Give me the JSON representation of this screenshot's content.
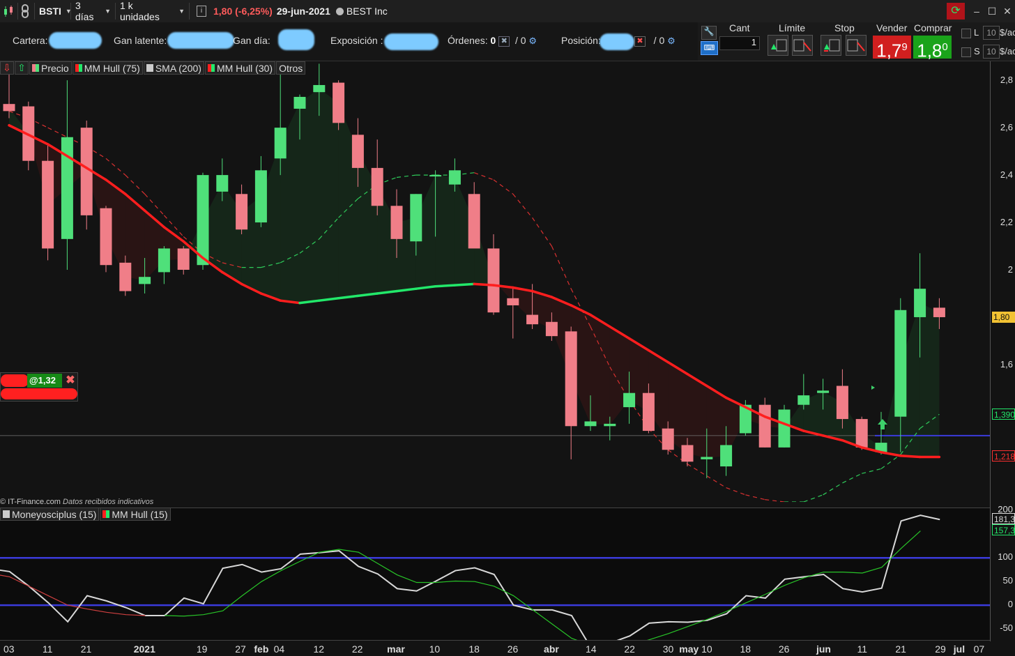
{
  "toolbar": {
    "symbol": "BSTI",
    "timeframe": "3 días",
    "units": "1 k unidades",
    "change": "1,80 (-6,25%)",
    "date": "29-jun-2021",
    "company": "BEST Inc"
  },
  "account": {
    "cartera_label": "Cartera:",
    "gan_latente_label": "Gan latente:",
    "gan_dia_label": "Gan día:",
    "exposicion_label": "Exposición :",
    "ordenes_label": "Órdenes:",
    "ordenes_value": "0",
    "ordenes_pending": "/ 0",
    "posicion_label": "Posición:",
    "posicion_pending": "/ 0"
  },
  "trade": {
    "cant_label": "Cant",
    "qty": "1",
    "limite_label": "Límite",
    "stop_label": "Stop",
    "vender_label": "Vender",
    "comprar_label": "Comprar",
    "sell_price": "1,7",
    "sell_sup": "9",
    "buy_price": "1,8",
    "buy_sup": "0",
    "L_label": "L",
    "S_label": "S",
    "L_value": "10",
    "S_value": "10",
    "L_unit": "$/ac",
    "S_unit": "$/ac"
  },
  "legend": {
    "precio": "Precio",
    "hull75": "MM Hull (75)",
    "sma200": "SMA (200)",
    "hull30": "MM Hull (30)",
    "otros": "Otros"
  },
  "order_marker": {
    "label": "@1,32"
  },
  "copyright": {
    "brand": "© IT-Finance.com",
    "note": "Datos recibidos indicativos"
  },
  "lower_legend": {
    "money": "Moneyosciplus (15)",
    "hull15": "MM Hull (15)"
  },
  "colors": {
    "bull": "#4fe07a",
    "bear": "#f07e88",
    "hull_down": "#ff1e1e",
    "hull_up": "#22e86a",
    "buy_bg": "#1aa31a",
    "sell_bg": "#d11f1f",
    "level_line": "#3b3bdc"
  },
  "chart_data": [
    {
      "type": "candlestick",
      "title": "",
      "ylim": [
        1.02,
        2.88
      ],
      "yticks": [
        "2,8",
        "2,6",
        "2,4",
        "2,2",
        "2",
        "1,6"
      ],
      "ytick_values": [
        2.8,
        2.6,
        2.4,
        2.2,
        2.0,
        1.6
      ],
      "price_tags": [
        {
          "label": "1,80",
          "value": 1.8,
          "color": "#f2c233"
        },
        {
          "label": "1,390",
          "value": 1.39,
          "color": "#22e86a"
        },
        {
          "label": "1,218",
          "value": 1.215,
          "color": "#ff3030"
        }
      ],
      "level_line": 1.3,
      "candles": [
        {
          "o": 2.7,
          "h": 2.84,
          "l": 2.64,
          "c": 2.67
        },
        {
          "o": 2.69,
          "h": 2.71,
          "l": 2.42,
          "c": 2.46
        },
        {
          "o": 2.46,
          "h": 2.53,
          "l": 2.04,
          "c": 2.09
        },
        {
          "o": 2.13,
          "h": 2.8,
          "l": 2.0,
          "c": 2.56
        },
        {
          "o": 2.6,
          "h": 2.63,
          "l": 2.17,
          "c": 2.23
        },
        {
          "o": 2.26,
          "h": 2.27,
          "l": 1.99,
          "c": 2.02
        },
        {
          "o": 2.03,
          "h": 2.06,
          "l": 1.89,
          "c": 1.91
        },
        {
          "o": 1.94,
          "h": 2.05,
          "l": 1.9,
          "c": 1.97
        },
        {
          "o": 1.99,
          "h": 2.1,
          "l": 1.94,
          "c": 2.09
        },
        {
          "o": 2.09,
          "h": 2.1,
          "l": 1.98,
          "c": 2.0
        },
        {
          "o": 2.02,
          "h": 2.41,
          "l": 2.0,
          "c": 2.4
        },
        {
          "o": 2.33,
          "h": 2.47,
          "l": 2.29,
          "c": 2.4
        },
        {
          "o": 2.32,
          "h": 2.36,
          "l": 2.15,
          "c": 2.17
        },
        {
          "o": 2.2,
          "h": 2.48,
          "l": 2.18,
          "c": 2.42
        },
        {
          "o": 2.47,
          "h": 2.9,
          "l": 2.4,
          "c": 2.6
        },
        {
          "o": 2.68,
          "h": 2.74,
          "l": 2.55,
          "c": 2.73
        },
        {
          "o": 2.75,
          "h": 2.87,
          "l": 2.65,
          "c": 2.78
        },
        {
          "o": 2.79,
          "h": 2.8,
          "l": 2.59,
          "c": 2.62
        },
        {
          "o": 2.57,
          "h": 2.64,
          "l": 2.35,
          "c": 2.43
        },
        {
          "o": 2.43,
          "h": 2.55,
          "l": 2.23,
          "c": 2.27
        },
        {
          "o": 2.27,
          "h": 2.34,
          "l": 2.05,
          "c": 2.13
        },
        {
          "o": 2.12,
          "h": 2.32,
          "l": 2.06,
          "c": 2.32
        },
        {
          "o": 2.4,
          "h": 2.42,
          "l": 2.14,
          "c": 2.4
        },
        {
          "o": 2.36,
          "h": 2.47,
          "l": 2.33,
          "c": 2.42
        },
        {
          "o": 2.32,
          "h": 2.37,
          "l": 2.17,
          "c": 2.09
        },
        {
          "o": 2.09,
          "h": 2.15,
          "l": 1.81,
          "c": 1.82
        },
        {
          "o": 1.88,
          "h": 1.93,
          "l": 1.71,
          "c": 1.85
        },
        {
          "o": 1.81,
          "h": 1.94,
          "l": 1.75,
          "c": 1.77
        },
        {
          "o": 1.78,
          "h": 1.82,
          "l": 1.7,
          "c": 1.72
        },
        {
          "o": 1.74,
          "h": 1.76,
          "l": 1.2,
          "c": 1.34
        },
        {
          "o": 1.34,
          "h": 1.47,
          "l": 1.32,
          "c": 1.36
        },
        {
          "o": 1.34,
          "h": 1.38,
          "l": 1.28,
          "c": 1.35
        },
        {
          "o": 1.42,
          "h": 1.57,
          "l": 1.35,
          "c": 1.48
        },
        {
          "o": 1.48,
          "h": 1.52,
          "l": 1.31,
          "c": 1.32
        },
        {
          "o": 1.33,
          "h": 1.36,
          "l": 1.22,
          "c": 1.24
        },
        {
          "o": 1.26,
          "h": 1.29,
          "l": 1.17,
          "c": 1.19
        },
        {
          "o": 1.2,
          "h": 1.33,
          "l": 1.12,
          "c": 1.21
        },
        {
          "o": 1.17,
          "h": 1.34,
          "l": 1.13,
          "c": 1.26
        },
        {
          "o": 1.31,
          "h": 1.45,
          "l": 1.3,
          "c": 1.43
        },
        {
          "o": 1.43,
          "h": 1.46,
          "l": 1.25,
          "c": 1.25
        },
        {
          "o": 1.25,
          "h": 1.43,
          "l": 1.25,
          "c": 1.41
        },
        {
          "o": 1.43,
          "h": 1.56,
          "l": 1.41,
          "c": 1.47
        },
        {
          "o": 1.48,
          "h": 1.54,
          "l": 1.41,
          "c": 1.49
        },
        {
          "o": 1.51,
          "h": 1.58,
          "l": 1.33,
          "c": 1.37
        },
        {
          "o": 1.37,
          "h": 1.38,
          "l": 1.24,
          "c": 1.25
        },
        {
          "o": 1.23,
          "h": 1.4,
          "l": 1.22,
          "c": 1.27
        },
        {
          "o": 1.38,
          "h": 1.88,
          "l": 1.23,
          "c": 1.83
        },
        {
          "o": 1.8,
          "h": 2.07,
          "l": 1.63,
          "c": 1.92
        },
        {
          "o": 1.84,
          "h": 1.88,
          "l": 1.75,
          "c": 1.8
        }
      ],
      "hull75": [
        2.61,
        2.57,
        2.53,
        2.48,
        2.43,
        2.38,
        2.32,
        2.25,
        2.18,
        2.12,
        2.05,
        1.99,
        1.94,
        1.9,
        1.87,
        1.86,
        1.87,
        1.88,
        1.89,
        1.9,
        1.91,
        1.92,
        1.93,
        1.935,
        1.94,
        1.935,
        1.925,
        1.91,
        1.885,
        1.85,
        1.81,
        1.76,
        1.71,
        1.66,
        1.61,
        1.56,
        1.51,
        1.46,
        1.42,
        1.38,
        1.35,
        1.32,
        1.3,
        1.28,
        1.25,
        1.23,
        1.215,
        1.21,
        1.21
      ],
      "hull75_up_segments": [
        [
          15,
          24
        ]
      ],
      "hull30": [
        2.67,
        2.64,
        2.6,
        2.56,
        2.52,
        2.47,
        2.4,
        2.32,
        2.23,
        2.14,
        2.07,
        2.03,
        2.01,
        2.01,
        2.03,
        2.07,
        2.13,
        2.22,
        2.3,
        2.36,
        2.39,
        2.4,
        2.4,
        2.4,
        2.41,
        2.38,
        2.32,
        2.22,
        2.1,
        1.92,
        1.76,
        1.59,
        1.45,
        1.33,
        1.24,
        1.18,
        1.13,
        1.08,
        1.05,
        1.03,
        1.02,
        1.02,
        1.05,
        1.1,
        1.14,
        1.16,
        1.22,
        1.33,
        1.39
      ],
      "xticks": [
        "03",
        "11",
        "21",
        "2021",
        "19",
        "27",
        "feb",
        "04",
        "12",
        "22",
        "mar",
        "10",
        "18",
        "26",
        "abr",
        "14",
        "22",
        "30",
        "may",
        "10",
        "18",
        "26",
        "jun",
        "11",
        "21",
        "29",
        "jul",
        "07"
      ],
      "xtick_positions": [
        0.009,
        0.048,
        0.087,
        0.146,
        0.204,
        0.243,
        0.264,
        0.282,
        0.322,
        0.361,
        0.4,
        0.439,
        0.479,
        0.518,
        0.557,
        0.597,
        0.636,
        0.675,
        0.696,
        0.714,
        0.753,
        0.792,
        0.832,
        0.871,
        0.91,
        0.95,
        0.969,
        0.989
      ],
      "xticks_bold": [
        "2021",
        "feb",
        "mar",
        "abr",
        "may",
        "jun",
        "jul"
      ]
    },
    {
      "type": "line",
      "title": "",
      "ylim": [
        -75,
        205
      ],
      "yticks": [
        "200",
        "100",
        "50",
        "0",
        "-50"
      ],
      "ytick_values": [
        200,
        100,
        50,
        0,
        -50
      ],
      "tags": [
        {
          "label": "181,3",
          "value": 181,
          "color": "#dddddd"
        },
        {
          "label": "157,3",
          "value": 158,
          "color": "#22e86a"
        }
      ],
      "hlines": [
        100,
        0
      ],
      "series": [
        {
          "key": "money",
          "values": [
            77,
            71,
            40,
            5,
            -35,
            20,
            9,
            -5,
            -22,
            -22,
            15,
            3,
            78,
            86,
            70,
            77,
            108,
            111,
            115,
            82,
            66,
            35,
            30,
            51,
            73,
            79,
            65,
            0,
            -10,
            -10,
            -22,
            -90,
            -80,
            -65,
            -38,
            -35,
            -36,
            -32,
            -18,
            20,
            15,
            55,
            60,
            65,
            35,
            28,
            36,
            178,
            190,
            181
          ],
          "color": "#d8d8d8"
        },
        {
          "key": "hull15",
          "values": [
            null,
            null,
            null,
            null,
            null,
            null,
            null,
            null,
            null,
            -22,
            -23,
            -20,
            -12,
            20,
            50,
            73,
            93,
            112,
            118,
            112,
            88,
            64,
            48,
            48,
            51,
            50,
            40,
            20,
            -10,
            -40,
            -70,
            -85,
            -91,
            -85,
            -73,
            -60,
            -45,
            -30,
            -13,
            5,
            23,
            42,
            58,
            70,
            70,
            68,
            80,
            120,
            157
          ],
          "color": "#28c428"
        },
        {
          "key": "hull15_down",
          "values": [
            67,
            60,
            40,
            20,
            0,
            -8,
            -15,
            -20,
            -22
          ],
          "color": "#d04040"
        }
      ]
    }
  ]
}
